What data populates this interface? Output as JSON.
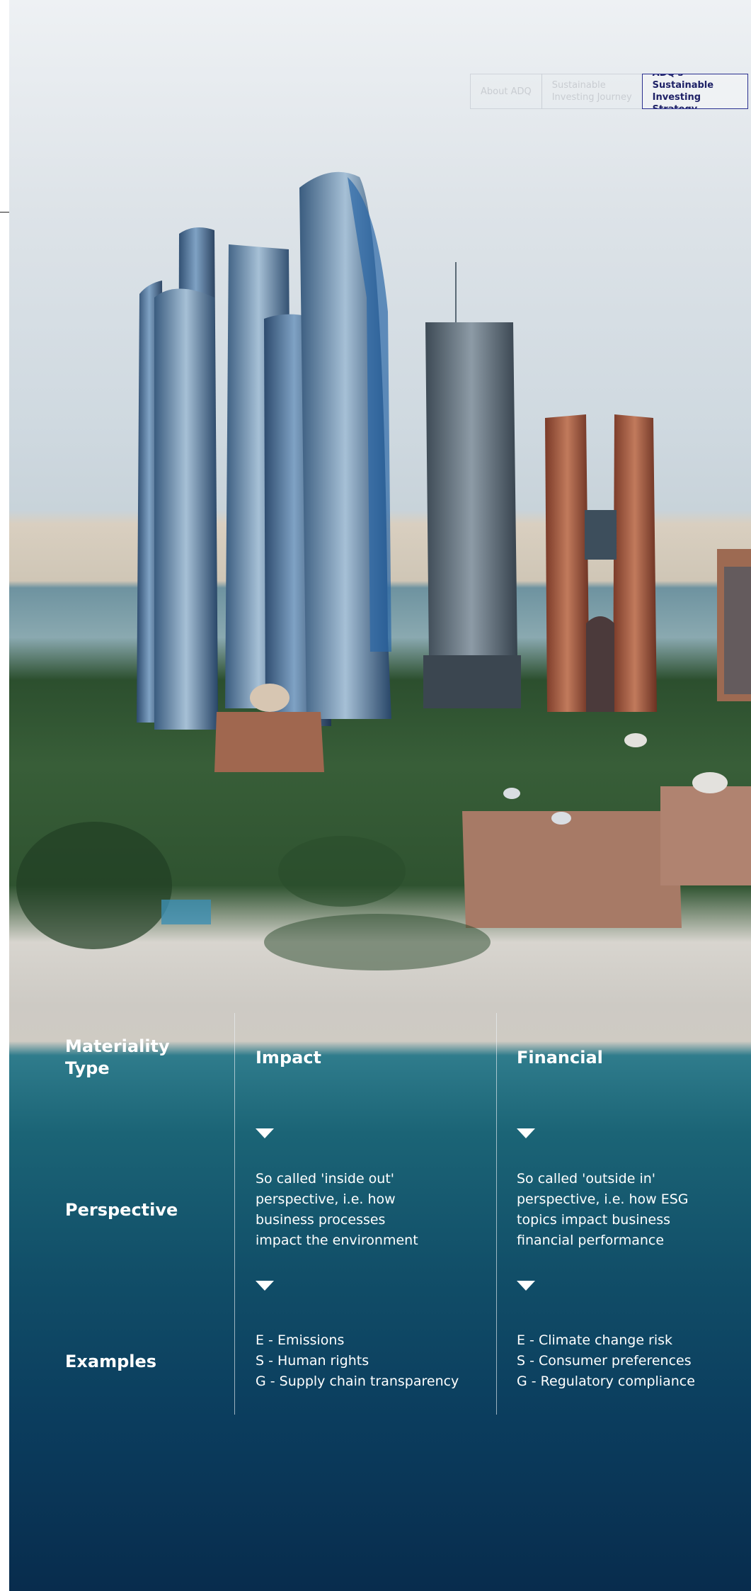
{
  "nav": {
    "tabs": [
      {
        "label": "About ADQ",
        "active": false
      },
      {
        "label": "Sustainable\nInvesting Journey",
        "active": false
      },
      {
        "label": "ADQ's Sustainable\nInvesting Strategy",
        "active": true
      }
    ]
  },
  "materiality_table": {
    "corner_label": "Materiality\nType",
    "columns": [
      {
        "title": "Impact"
      },
      {
        "title": "Financial"
      }
    ],
    "rows": {
      "perspective": {
        "label": "Perspective",
        "impact": "So called 'inside out'\nperspective, i.e. how\nbusiness processes\nimpact the environment",
        "financial": "So called 'outside in'\nperspective, i.e. how ESG\ntopics impact business\nfinancial performance"
      },
      "examples": {
        "label": "Examples",
        "impact": "E - Emissions\nS - Human rights\nG - Supply chain transparency",
        "financial": "E - Climate change risk\nS - Consumer preferences\nG - Regulatory compliance"
      }
    }
  },
  "colors": {
    "text_light": "#ffffff",
    "active_tab_border": "#2a2f8f",
    "active_tab_text": "#1e2166",
    "divider": "#ebf0f5"
  },
  "icons": {
    "down_arrow": "down-triangle-icon"
  }
}
